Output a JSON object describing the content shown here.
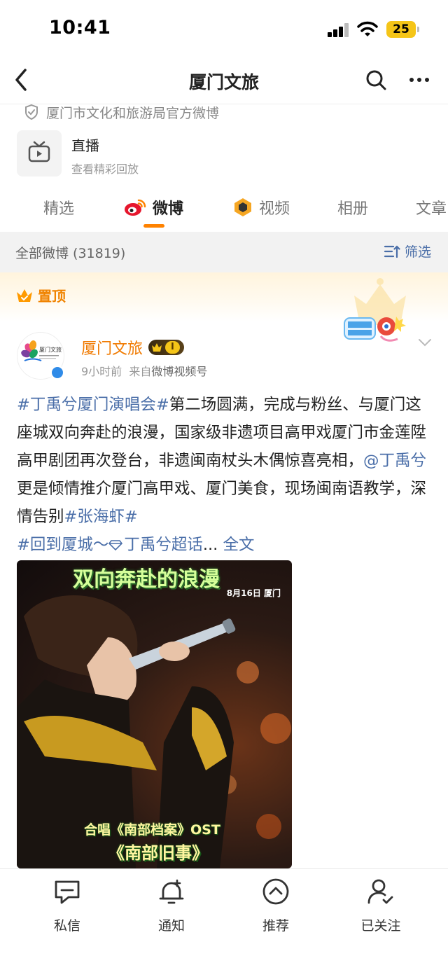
{
  "status_bar": {
    "time": "10:41",
    "battery": "25"
  },
  "nav": {
    "title": "厦门文旅"
  },
  "profile": {
    "verified_text": "厦门市文化和旅游局官方微博"
  },
  "live": {
    "title": "直播",
    "subtitle": "查看精彩回放"
  },
  "tabs": [
    {
      "label": "精选"
    },
    {
      "label": "微博"
    },
    {
      "label": "视频"
    },
    {
      "label": "相册"
    },
    {
      "label": "文章"
    }
  ],
  "filter_bar": {
    "count_text": "全部微博 (31819)",
    "filter_label": "筛选"
  },
  "pinned": {
    "label": "置顶"
  },
  "post": {
    "author": "厦门文旅",
    "vip_level": "I",
    "avatar_text": "厦门文旅",
    "time": "9小时前",
    "source_prefix": "来自",
    "source": "微博视频号",
    "text_parts": {
      "tag1": "#丁禹兮厦门演唱会#",
      "t1": "第二场圆满，完成与粉丝、与厦门这座城双向奔赴的浪漫，国家级非遗项目高甲戏厦门市金莲陞高甲剧团再次登台，非遗闽南杖头木偶惊喜亮相，",
      "mention": "@丁禹兮",
      "t2": " 更是倾情推介厦门高甲戏、厦门美食，现场闽南语教学，深情告别",
      "tag2": "#张海虾#",
      "tag3": "#回到厦城～",
      "supertopic": "丁禹兮超话",
      "ellipsis": "... ",
      "full_text": "全文"
    },
    "image": {
      "caption_top": "双向奔赴的浪漫",
      "caption_date": "8月16日 厦门",
      "caption_bottom1": "合唱《南部档案》OST",
      "caption_bottom2": "《南部旧事》"
    }
  },
  "bottom_nav": [
    {
      "label": "私信",
      "icon": "message-icon"
    },
    {
      "label": "通知",
      "icon": "bell-icon"
    },
    {
      "label": "推荐",
      "icon": "recommend-icon"
    },
    {
      "label": "已关注",
      "icon": "followed-icon"
    }
  ],
  "colors": {
    "accent": "#ff8200",
    "link": "#4a6ea8",
    "author": "#f07a00"
  }
}
